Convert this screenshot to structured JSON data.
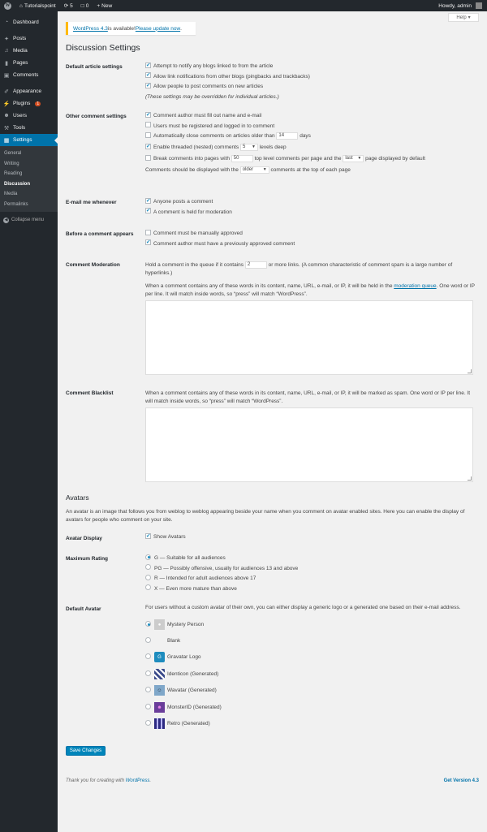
{
  "adminbar": {
    "site_name": "Tutorialspoint",
    "updates_count": "5",
    "comments_count": "0",
    "new_label": "New",
    "howdy": "Howdy, admin"
  },
  "sidebar": {
    "items": [
      {
        "label": "Dashboard",
        "icon": "dashboard-icon"
      },
      {
        "label": "Posts",
        "icon": "pin-icon"
      },
      {
        "label": "Media",
        "icon": "media-icon"
      },
      {
        "label": "Pages",
        "icon": "page-icon"
      },
      {
        "label": "Comments",
        "icon": "comment-icon"
      },
      {
        "label": "Appearance",
        "icon": "brush-icon"
      },
      {
        "label": "Plugins",
        "icon": "plugin-icon",
        "badge": "1"
      },
      {
        "label": "Users",
        "icon": "users-icon"
      },
      {
        "label": "Tools",
        "icon": "wrench-icon"
      },
      {
        "label": "Settings",
        "icon": "settings-icon"
      }
    ],
    "submenu": [
      "General",
      "Writing",
      "Reading",
      "Discussion",
      "Media",
      "Permalinks"
    ],
    "collapse": "Collapse menu"
  },
  "help": "Help",
  "notice": {
    "link1": "WordPress 4.3",
    "middle": " is available! ",
    "link2": "Please update now",
    "end": "."
  },
  "title": "Discussion Settings",
  "default_article": {
    "label": "Default article settings",
    "opt1": "Attempt to notify any blogs linked to from the article",
    "opt2": "Allow link notifications from other blogs (pingbacks and trackbacks)",
    "opt3": "Allow people to post comments on new articles",
    "note": "(These settings may be overridden for individual articles.)"
  },
  "other_comment": {
    "label": "Other comment settings",
    "opt1": "Comment author must fill out name and e-mail",
    "opt2": "Users must be registered and logged in to comment",
    "opt3_a": "Automatically close comments on articles older than",
    "opt3_val": "14",
    "opt3_b": "days",
    "opt4_a": "Enable threaded (nested) comments",
    "opt4_val": "5",
    "opt4_b": "levels deep",
    "opt5_a": "Break comments into pages with",
    "opt5_val": "50",
    "opt5_b": "top level comments per page and the",
    "opt5_sel": "last",
    "opt5_c": "page displayed by default",
    "opt6_a": "Comments should be displayed with the",
    "opt6_sel": "older",
    "opt6_b": "comments at the top of each page"
  },
  "email_me": {
    "label": "E-mail me whenever",
    "opt1": "Anyone posts a comment",
    "opt2": "A comment is held for moderation"
  },
  "before_comment": {
    "label": "Before a comment appears",
    "opt1": "Comment must be manually approved",
    "opt2": "Comment author must have a previously approved comment"
  },
  "moderation": {
    "label": "Comment Moderation",
    "line1_a": "Hold a comment in the queue if it contains",
    "line1_val": "2",
    "line1_b": "or more links. (A common characteristic of comment spam is a large number of hyperlinks.)",
    "para_a": "When a comment contains any of these words in its content, name, URL, e-mail, or IP, it will be held in the ",
    "para_link": "moderation queue",
    "para_b": ". One word or IP per line. It will match inside words, so “press” will match “WordPress”."
  },
  "blacklist": {
    "label": "Comment Blacklist",
    "para": "When a comment contains any of these words in its content, name, URL, e-mail, or IP, it will be marked as spam. One word or IP per line. It will match inside words, so “press” will match “WordPress”."
  },
  "avatars": {
    "title": "Avatars",
    "desc": "An avatar is an image that follows you from weblog to weblog appearing beside your name when you comment on avatar enabled sites. Here you can enable the display of avatars for people who comment on your site.",
    "display_label": "Avatar Display",
    "display_opt": "Show Avatars",
    "rating_label": "Maximum Rating",
    "ratings": [
      "G — Suitable for all audiences",
      "PG — Possibly offensive, usually for audiences 13 and above",
      "R — Intended for adult audiences above 17",
      "X — Even more mature than above"
    ],
    "default_label": "Default Avatar",
    "default_desc": "For users without a custom avatar of their own, you can either display a generic logo or a generated one based on their e-mail address.",
    "defaults": [
      "Mystery Person",
      "Blank",
      "Gravatar Logo",
      "Identicon (Generated)",
      "Wavatar (Generated)",
      "MonsterID (Generated)",
      "Retro (Generated)"
    ]
  },
  "save": "Save Changes",
  "footer": {
    "left_a": "Thank you for creating with ",
    "left_link": "WordPress",
    "left_b": ".",
    "right": "Get Version 4.3"
  },
  "colors": {
    "accent": "#0073aa",
    "sidebar": "#23282d",
    "notice": "#ffba00"
  }
}
